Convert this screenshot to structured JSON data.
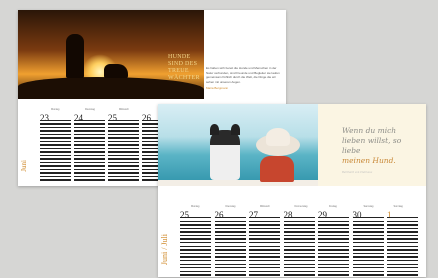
{
  "back_calendar": {
    "photo_quote": "Hunde sind des treue Wächter",
    "text": "Es haben sich bereit die Hunde und Menschen in der Natur verbunden, sind Freunde und Begleiter sie laufen gemeinsam fröhlich durch die Welt, die Dinge die wir sehen mit unseren Augen.",
    "signature": "Maria Bergmann",
    "month_label": "Juni",
    "days": [
      {
        "num": "23",
        "weekday": "Montag"
      },
      {
        "num": "24",
        "weekday": "Dienstag"
      },
      {
        "num": "25",
        "weekday": "Mittwoch"
      },
      {
        "num": "26",
        "weekday": ""
      }
    ]
  },
  "front_calendar": {
    "quote_lines": [
      "Wenn du mich",
      "lieben willst, so liebe",
      "meinen Hund."
    ],
    "quote_source": "Bernhard von Clairvaux",
    "month_label": "Juni / Juli",
    "days": [
      {
        "num": "25",
        "weekday": "Montag",
        "accent": false
      },
      {
        "num": "26",
        "weekday": "Dienstag",
        "accent": false
      },
      {
        "num": "27",
        "weekday": "Mittwoch",
        "accent": false
      },
      {
        "num": "28",
        "weekday": "Donnerstag",
        "accent": false
      },
      {
        "num": "29",
        "weekday": "Freitag",
        "accent": false
      },
      {
        "num": "30",
        "weekday": "Samstag",
        "accent": false
      },
      {
        "num": "1",
        "weekday": "Sonntag",
        "accent": true
      }
    ]
  },
  "colors": {
    "accent": "#d08a2a",
    "background": "#d6d6d4"
  }
}
